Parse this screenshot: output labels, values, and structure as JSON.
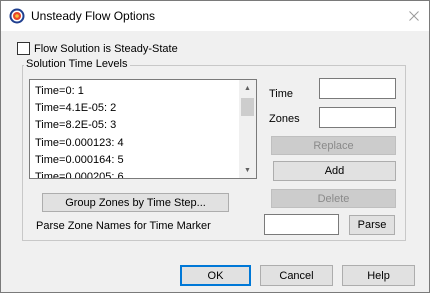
{
  "window": {
    "title": "Unsteady Flow Options"
  },
  "steady_state": {
    "label": "Flow Solution is Steady-State",
    "checked": false
  },
  "solution_time_levels": {
    "group_label": "Solution Time Levels",
    "items": [
      "Time=0: 1",
      "Time=4.1E-05: 2",
      "Time=8.2E-05: 3",
      "Time=0.000123: 4",
      "Time=0.000164: 5",
      "Time=0.000205: 6"
    ],
    "time_label": "Time",
    "time_value": "",
    "zones_label": "Zones",
    "zones_value": "",
    "replace_button": "Replace",
    "add_button": "Add",
    "delete_button": "Delete",
    "group_zones_button": "Group Zones by Time Step...",
    "parse_label": "Parse Zone Names for Time Marker",
    "parse_value": "",
    "parse_button": "Parse"
  },
  "footer": {
    "ok": "OK",
    "cancel": "Cancel",
    "help": "Help"
  }
}
